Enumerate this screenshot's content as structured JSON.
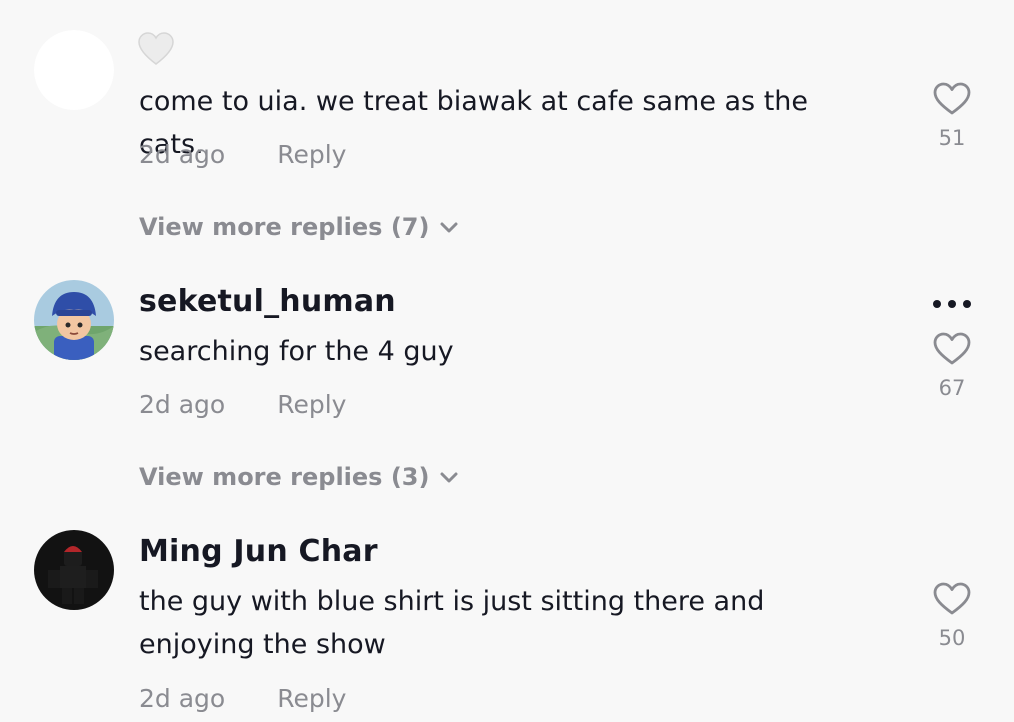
{
  "comments": [
    {
      "username": "",
      "username_emoji": "white-heart-emoji",
      "text": "come to uia. we treat biawak at cafe same as the cats.",
      "time": "2d ago",
      "reply_label": "Reply",
      "likes": "51",
      "view_more": "View more replies (7)",
      "avatar": "blank-avatar"
    },
    {
      "username": "seketul_human",
      "text": "searching for the 4 guy",
      "time": "2d ago",
      "reply_label": "Reply",
      "likes": "67",
      "view_more": "View more replies (3)",
      "avatar": "cartoon-boy-blue-hat-avatar"
    },
    {
      "username": "Ming Jun Char",
      "text_lines": [
        "the guy with blue shirt is just sitting there and",
        "enjoying the show"
      ],
      "time": "2d ago",
      "reply_label": "Reply",
      "likes": "50",
      "avatar": "roblox-character-avatar"
    }
  ],
  "icons": {
    "like": "heart-outline-icon",
    "more": "more-options-icon",
    "expand": "chevron-down-icon"
  },
  "colors": {
    "background": "#f8f8f8",
    "primary_text": "#161823",
    "secondary_text": "#8a8b91"
  }
}
